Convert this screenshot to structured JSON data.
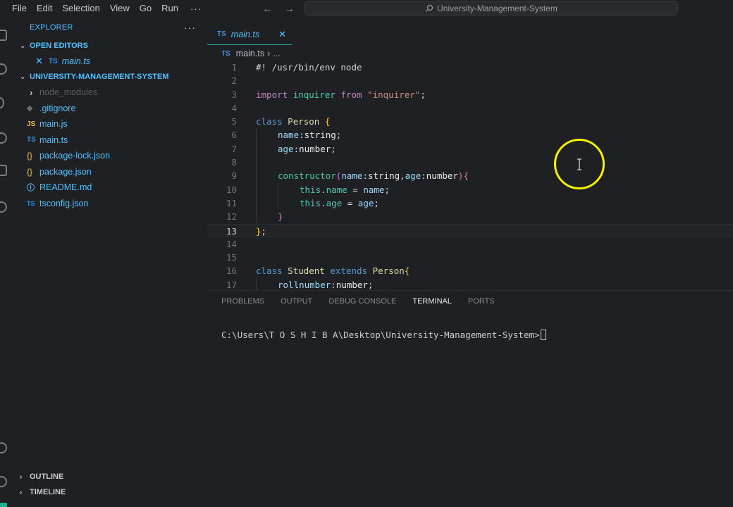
{
  "menu": [
    "File",
    "Edit",
    "Selection",
    "View",
    "Go",
    "Run"
  ],
  "menu_more": "···",
  "nav": {
    "back": "←",
    "forward": "→"
  },
  "search": {
    "text": "University-Management-System"
  },
  "explorer": {
    "title": "EXPLORER",
    "more": "···",
    "open_editors_title": "OPEN EDITORS",
    "open_editor_close": "✕",
    "open_editor_badge": "TS",
    "open_editor_file": "main.ts",
    "project_title": "UNIVERSITY-MANAGEMENT-SYSTEM",
    "files": [
      {
        "name": "node_modules",
        "icon": "›",
        "kind": "folder",
        "dim": true
      },
      {
        "name": ".gitignore",
        "icon": "◆",
        "kind": "git"
      },
      {
        "name": "main.js",
        "icon": "JS",
        "kind": "js"
      },
      {
        "name": "main.ts",
        "icon": "TS",
        "kind": "ts"
      },
      {
        "name": "package-lock.json",
        "icon": "{}",
        "kind": "json"
      },
      {
        "name": "package.json",
        "icon": "{}",
        "kind": "json"
      },
      {
        "name": "README.md",
        "icon": "ⓘ",
        "kind": "info"
      },
      {
        "name": "tsconfig.json",
        "icon": "TS",
        "kind": "tsconf"
      }
    ],
    "outline_title": "OUTLINE",
    "timeline_title": "TIMELINE"
  },
  "tab": {
    "badge": "TS",
    "label": "main.ts",
    "close": "✕"
  },
  "breadcrumb": {
    "badge": "TS",
    "file": "main.ts",
    "sep": "›",
    "more": "..."
  },
  "code": {
    "current_line": 13,
    "lines": [
      {
        "n": "1",
        "indent": 0,
        "tokens": [
          {
            "t": "#! /usr/bin/env node",
            "c": "cm"
          }
        ]
      },
      {
        "n": "2",
        "indent": 0,
        "tokens": []
      },
      {
        "n": "3",
        "indent": 0,
        "tokens": [
          {
            "t": "import",
            "c": "kw"
          },
          {
            "t": " "
          },
          {
            "t": "inquirer",
            "c": "cls"
          },
          {
            "t": " "
          },
          {
            "t": "from",
            "c": "kw"
          },
          {
            "t": " "
          },
          {
            "t": "\"inquirer\"",
            "c": "str"
          },
          {
            "t": ";"
          }
        ]
      },
      {
        "n": "4",
        "indent": 0,
        "tokens": []
      },
      {
        "n": "5",
        "indent": 0,
        "tokens": [
          {
            "t": "class",
            "c": "kw2"
          },
          {
            "t": " "
          },
          {
            "t": "Person",
            "c": "fnc"
          },
          {
            "t": " "
          },
          {
            "t": "{",
            "c": "br1"
          }
        ]
      },
      {
        "n": "6",
        "indent": 1,
        "tokens": [
          {
            "t": "name",
            "c": "prop"
          },
          {
            "t": ":"
          },
          {
            "t": "string",
            "c": "typ"
          },
          {
            "t": ";"
          }
        ]
      },
      {
        "n": "7",
        "indent": 1,
        "tokens": [
          {
            "t": "age",
            "c": "prop"
          },
          {
            "t": ":"
          },
          {
            "t": "number",
            "c": "typ"
          },
          {
            "t": ";"
          }
        ]
      },
      {
        "n": "8",
        "indent": 1,
        "tokens": []
      },
      {
        "n": "9",
        "indent": 1,
        "tokens": [
          {
            "t": "constructor",
            "c": "cls"
          },
          {
            "t": "(",
            "c": "br2"
          },
          {
            "t": "name",
            "c": "prop"
          },
          {
            "t": ":"
          },
          {
            "t": "string",
            "c": "typ"
          },
          {
            "t": ","
          },
          {
            "t": "age",
            "c": "prop"
          },
          {
            "t": ":"
          },
          {
            "t": "number",
            "c": "typ"
          },
          {
            "t": ")",
            "c": "br2"
          },
          {
            "t": "{",
            "c": "br2"
          }
        ]
      },
      {
        "n": "10",
        "indent": 2,
        "tokens": [
          {
            "t": "this",
            "c": "cls"
          },
          {
            "t": "."
          },
          {
            "t": "name",
            "c": "cls"
          },
          {
            "t": " = "
          },
          {
            "t": "name",
            "c": "prop"
          },
          {
            "t": ";"
          }
        ]
      },
      {
        "n": "11",
        "indent": 2,
        "tokens": [
          {
            "t": "this",
            "c": "cls"
          },
          {
            "t": "."
          },
          {
            "t": "age",
            "c": "cls"
          },
          {
            "t": " = "
          },
          {
            "t": "age",
            "c": "prop"
          },
          {
            "t": ";"
          }
        ]
      },
      {
        "n": "12",
        "indent": 1,
        "tokens": [
          {
            "t": "}",
            "c": "br2"
          }
        ]
      },
      {
        "n": "13",
        "indent": 0,
        "tokens": [
          {
            "t": "}",
            "c": "br1"
          },
          {
            "t": ";"
          }
        ]
      },
      {
        "n": "14",
        "indent": 0,
        "tokens": []
      },
      {
        "n": "15",
        "indent": 0,
        "tokens": []
      },
      {
        "n": "16",
        "indent": 0,
        "tokens": [
          {
            "t": "class",
            "c": "kw2"
          },
          {
            "t": " "
          },
          {
            "t": "Student",
            "c": "fnc"
          },
          {
            "t": " "
          },
          {
            "t": "extends",
            "c": "kw2"
          },
          {
            "t": " "
          },
          {
            "t": "Person",
            "c": "fnc"
          },
          {
            "t": "{",
            "c": "br1"
          }
        ]
      },
      {
        "n": "17",
        "indent": 1,
        "tokens": [
          {
            "t": "rollnumber",
            "c": "prop"
          },
          {
            "t": ":"
          },
          {
            "t": "number",
            "c": "typ"
          },
          {
            "t": ";"
          }
        ]
      }
    ]
  },
  "panel": {
    "tabs": [
      "PROBLEMS",
      "OUTPUT",
      "DEBUG CONSOLE",
      "TERMINAL",
      "PORTS"
    ],
    "active_tab": "TERMINAL",
    "terminal_prompt": "C:\\Users\\T O S H I B A\\Desktop\\University-Management-System>"
  },
  "colors": {
    "accent": "#1ab29a",
    "highlight_ring": "#f3f000",
    "link_blue": "#4fc1ff"
  }
}
